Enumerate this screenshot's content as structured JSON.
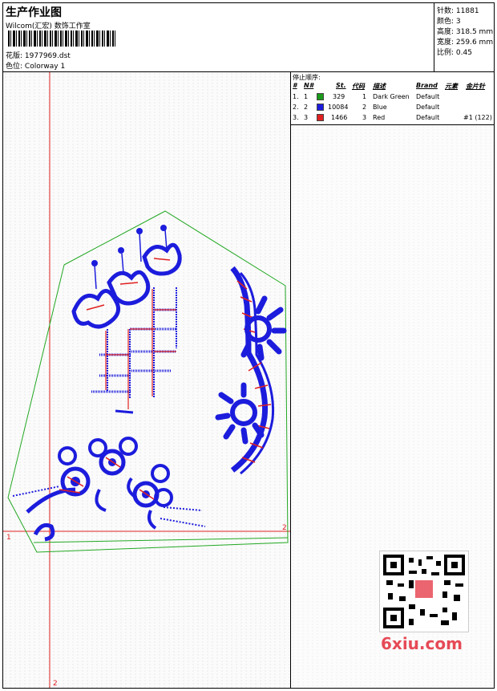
{
  "header": {
    "title": "生产作业图",
    "studio": "Wilcom(汇宏) 数饰工作室",
    "design_label": "花版:",
    "design_file": "1977969.dst",
    "colorway_label": "色位:",
    "colorway": "Colorway 1"
  },
  "stats": {
    "stitches_label": "针数:",
    "stitches": "11881",
    "colors_label": "颜色:",
    "colors": "3",
    "height_label": "高度:",
    "height": "318.5 mm",
    "width_label": "宽度:",
    "width": "259.6 mm",
    "scale_label": "比例:",
    "scale": "0.45"
  },
  "stop_sequence": {
    "title": "停止顺序:",
    "headers": [
      "#",
      "N#",
      "St.",
      "代码",
      "描述",
      "Brand",
      "元素",
      "金片针"
    ],
    "rows": [
      {
        "index": "1.",
        "n": "1",
        "stitches": "329",
        "code": "1",
        "desc": "Dark Green",
        "brand": "Default",
        "element": "",
        "sequin": "",
        "color": "#1a9a1a"
      },
      {
        "index": "2.",
        "n": "2",
        "stitches": "10084",
        "code": "2",
        "desc": "Blue",
        "brand": "Default",
        "element": "",
        "sequin": "",
        "color": "#1c1cdd"
      },
      {
        "index": "3.",
        "n": "3",
        "stitches": "1466",
        "code": "3",
        "desc": "Red",
        "brand": "Default",
        "element": "#1 (122)",
        "sequin": "",
        "color": "#e02020"
      }
    ]
  },
  "canvas": {
    "marker_1": "1",
    "marker_2": "2",
    "marker_2b": "2",
    "thread_green": "#22a822",
    "thread_blue": "#1c1cdd",
    "thread_red": "#e02020",
    "guide_color": "#e02020"
  },
  "watermark": "6xiu.com"
}
